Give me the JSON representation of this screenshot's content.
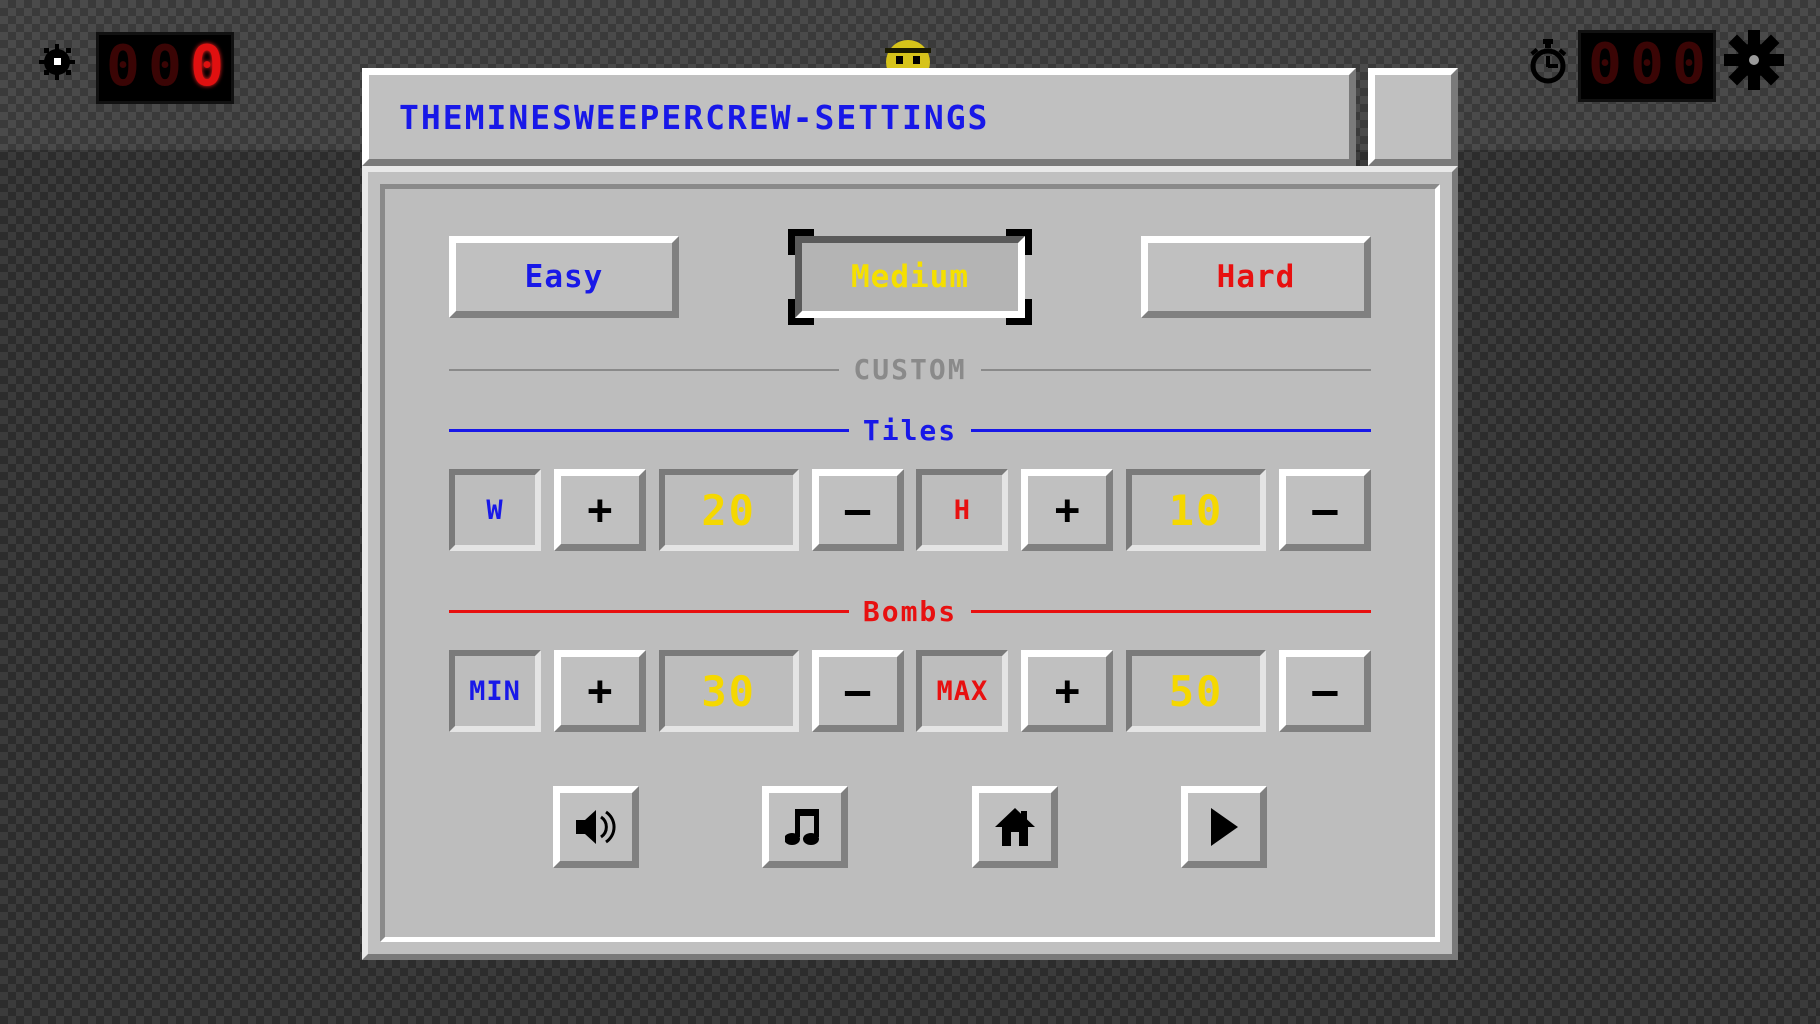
{
  "hud": {
    "bomb_icon": "bomb-icon",
    "bomb_counter": {
      "digits": [
        "0",
        "0",
        "0"
      ],
      "lit": [
        false,
        false,
        true
      ],
      "value": "000"
    },
    "stopwatch_icon": "stopwatch-icon",
    "timer_counter": {
      "digits": [
        "0",
        "0",
        "0"
      ],
      "lit": [
        false,
        false,
        false
      ],
      "value": "000"
    },
    "gear_icon": "gear-icon",
    "smiley_icon": "smiley-face-icon"
  },
  "dialog": {
    "title": "THEMINESWEEPERCREW-SETTINGS",
    "close_label": ""
  },
  "difficulty": {
    "options": [
      {
        "label": "Easy",
        "selected": false,
        "color": "#1818e8"
      },
      {
        "label": "Medium",
        "selected": true,
        "color": "#f5e000"
      },
      {
        "label": "Hard",
        "selected": false,
        "color": "#e81010"
      }
    ],
    "selected": "Medium"
  },
  "sections": {
    "custom": {
      "label": "CUSTOM",
      "color": "#8a8a8a"
    },
    "tiles": {
      "label": "Tiles",
      "color": "#1818e8"
    },
    "bombs": {
      "label": "Bombs",
      "color": "#e81010"
    }
  },
  "tiles": {
    "width": {
      "label": "W",
      "label_color": "#1818e8",
      "value": "20",
      "plus": "+",
      "minus": "—"
    },
    "height": {
      "label": "H",
      "label_color": "#e81010",
      "value": "10",
      "plus": "+",
      "minus": "—"
    }
  },
  "bombs": {
    "min": {
      "label": "MIN",
      "label_color": "#1818e8",
      "value": "30",
      "plus": "+",
      "minus": "—"
    },
    "max": {
      "label": "MAX",
      "label_color": "#e81010",
      "value": "50",
      "plus": "+",
      "minus": "—"
    }
  },
  "actions": [
    {
      "name": "sound-icon",
      "title": "Sound"
    },
    {
      "name": "music-note-icon",
      "title": "Music"
    },
    {
      "name": "home-icon",
      "title": "Home"
    },
    {
      "name": "play-icon",
      "title": "Play"
    }
  ],
  "colors": {
    "face": "#c0c0c0",
    "highlight": "#ffffff",
    "shadow": "#808080",
    "blue": "#1818e8",
    "red": "#e81010",
    "yellow": "#f5d800",
    "led_on": "#e01010",
    "led_off": "#3a0505"
  }
}
